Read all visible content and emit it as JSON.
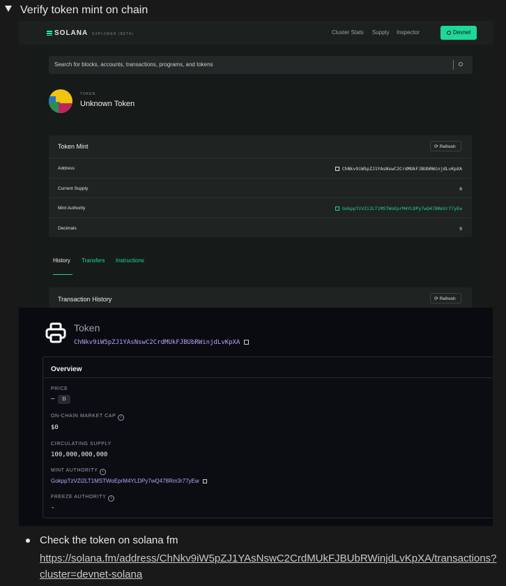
{
  "toggle": {
    "title": "Verify token mint on chain"
  },
  "explorer": {
    "logo": "SOLANA",
    "logo_sub": "EXPLORER (BETA)",
    "nav": [
      "Cluster Stats",
      "Supply",
      "Inspector"
    ],
    "cluster_button": "Devnet",
    "search_placeholder": "Search for blocks, accounts, transactions, programs, and tokens",
    "token_kicker": "TOKEN",
    "token_title": "Unknown Token",
    "mint_card": {
      "title": "Token Mint",
      "refresh": "Refresh",
      "rows": [
        {
          "label": "Address",
          "value": "ChNkv9iW5pZJ1YAsNswC2CrdMUkFJBUbRWinjdLvKpXA"
        },
        {
          "label": "Current Supply",
          "value": "0"
        },
        {
          "label": "Mint Authority",
          "value": "GokppTzVZi2LT1MSTWoEprM4YLDPy7wQ478Rm3r77yEw"
        },
        {
          "label": "Decimals",
          "value": "9"
        }
      ]
    },
    "tabs": [
      "History",
      "Transfers",
      "Instructions"
    ],
    "history_card": {
      "title": "Transaction History",
      "refresh": "Refresh"
    }
  },
  "solfm": {
    "token_label": "Token",
    "address": "ChNkv9iW5pZJ1YAsNswC2CrdMUkFJBUbRWinjdLvKpXA",
    "overview_title": "Overview",
    "price_label": "PRICE",
    "price_value": "–",
    "price_badge": "D",
    "market_cap_label": "ON-CHAIN MARKET CAP",
    "market_cap_value": "$0",
    "supply_label": "CIRCULATING SUPPLY",
    "supply_value": "100,000,000,000",
    "mint_authority_label": "MINT AUTHORITY",
    "mint_authority_value": "GokppTzVZi2LT1MSTWoEprM4YLDPy7wQ478Rm3r77yEw",
    "freeze_authority_label": "FREEZE AUTHORITY",
    "freeze_authority_value": "-"
  },
  "bullet": {
    "text": "Check the token on solana fm",
    "url": "https://solana.fm/address/ChNkv9iW5pZJ1YAsNswC2CrdMUkFJBUbRWinjdLvKpXA/transactions?cluster=devnet-solana"
  },
  "colors": {
    "accent_green": "#1dd79b",
    "fm_purple": "#b9a3ff",
    "page_bg": "#191919"
  },
  "icons": [
    "toggle-arrow-icon",
    "copy-icon",
    "refresh-icon",
    "search-icon",
    "info-icon",
    "printer-icon"
  ]
}
